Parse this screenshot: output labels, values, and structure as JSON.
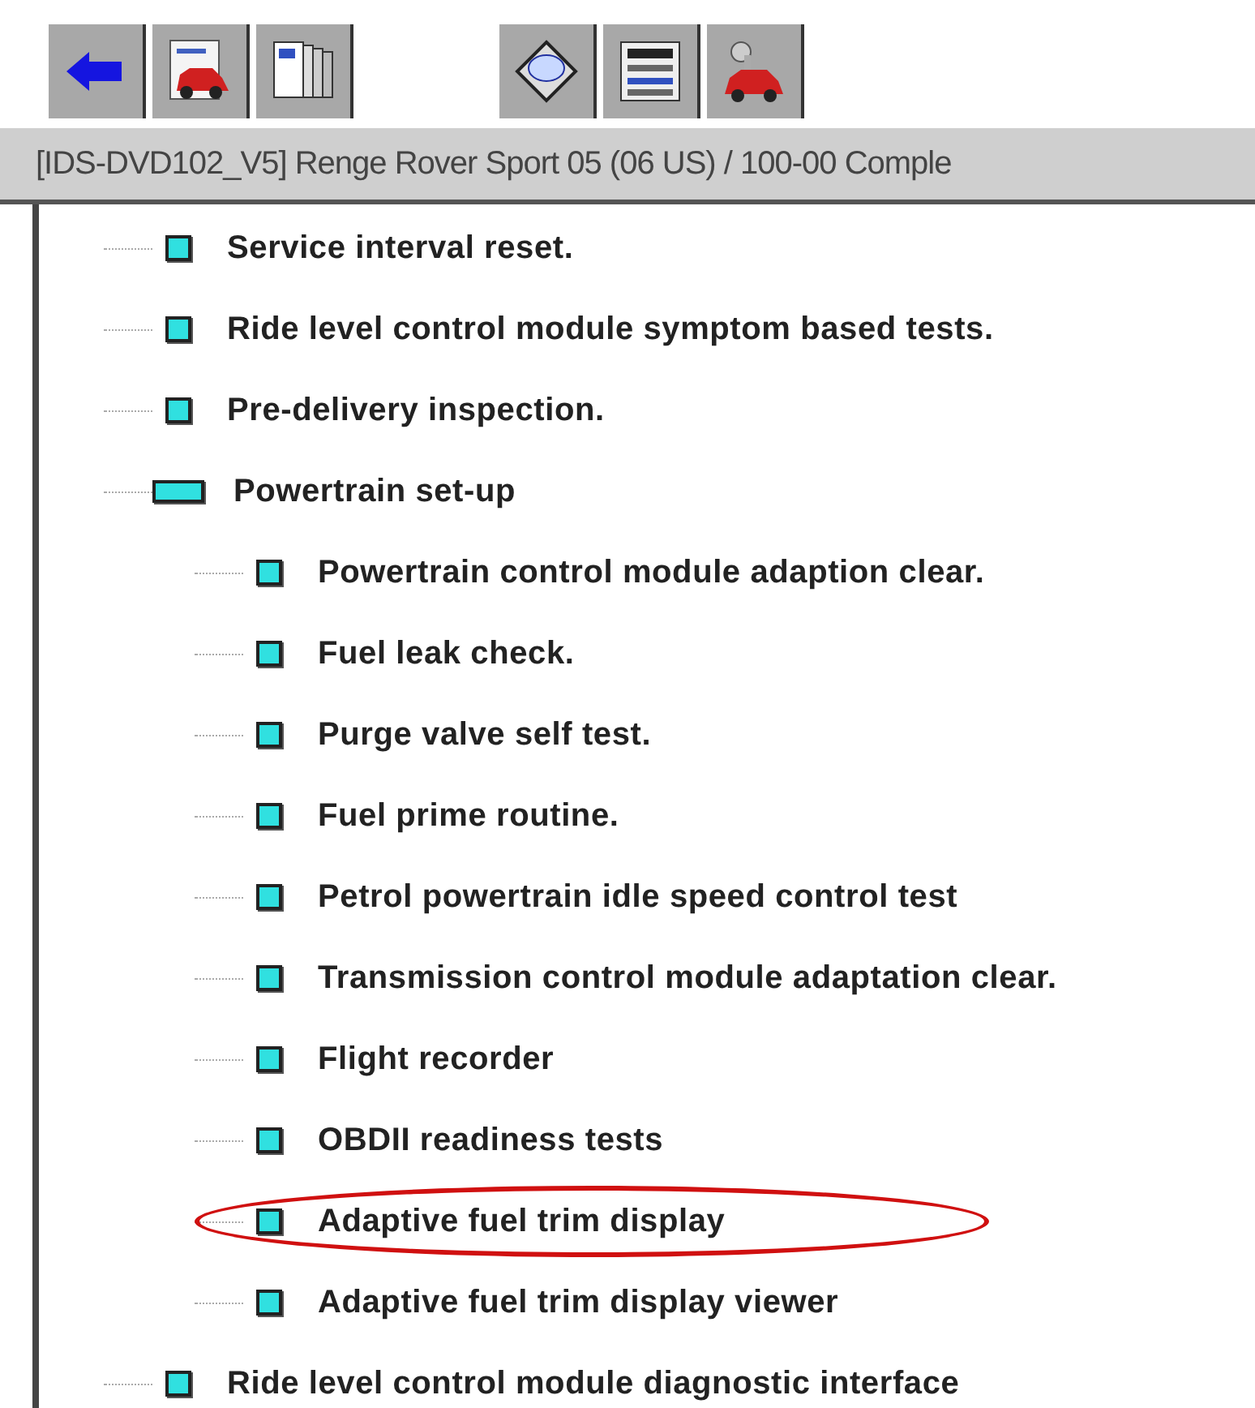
{
  "toolbar": {
    "left_buttons": [
      {
        "kind": "back"
      },
      {
        "kind": "car-doc"
      },
      {
        "kind": "book"
      }
    ],
    "right_buttons": [
      {
        "kind": "disc"
      },
      {
        "kind": "list"
      },
      {
        "kind": "car-key"
      }
    ]
  },
  "path_bar": {
    "text": "[IDS-DVD102_V5]  Renge Rover Sport 05 (06 US) / 100-00 Comple"
  },
  "tree": [
    {
      "label": "Service interval reset.",
      "highlighted": false
    },
    {
      "label": "Ride level control module symptom based tests.",
      "highlighted": false
    },
    {
      "label": "Pre-delivery inspection.",
      "highlighted": false
    },
    {
      "label": "Powertrain set-up",
      "highlighted": false,
      "expanded": true,
      "children": [
        {
          "label": "Powertrain control module adaption clear.",
          "highlighted": false
        },
        {
          "label": "Fuel leak check.",
          "highlighted": false
        },
        {
          "label": "Purge valve self test.",
          "highlighted": false
        },
        {
          "label": "Fuel prime routine.",
          "highlighted": false
        },
        {
          "label": "Petrol powertrain idle speed control test",
          "highlighted": false
        },
        {
          "label": "Transmission control module adaptation clear.",
          "highlighted": false
        },
        {
          "label": "Flight recorder",
          "highlighted": false
        },
        {
          "label": "OBDII readiness tests",
          "highlighted": false
        },
        {
          "label": "Adaptive fuel trim display",
          "highlighted": true
        },
        {
          "label": "Adaptive fuel trim display viewer",
          "highlighted": false
        }
      ]
    },
    {
      "label": "Ride level control module diagnostic interface",
      "highlighted": false
    }
  ]
}
